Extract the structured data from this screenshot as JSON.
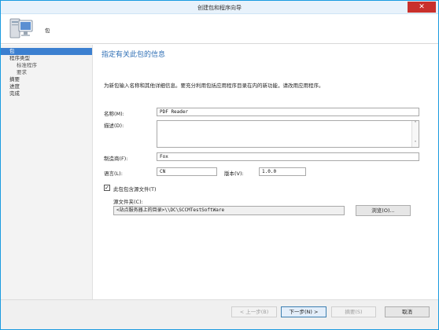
{
  "window": {
    "title": "创建包和程序向导",
    "close_glyph": "✕"
  },
  "header": {
    "title": "包",
    "icon": "computer-icon"
  },
  "sidebar": {
    "items": [
      {
        "label": "包",
        "active": true
      },
      {
        "label": "程序类型",
        "active": false
      },
      {
        "label": "标准程序",
        "active": false
      },
      {
        "label": "要求",
        "active": false
      },
      {
        "label": "摘要",
        "active": false
      },
      {
        "label": "进度",
        "active": false
      },
      {
        "label": "完成",
        "active": false
      }
    ]
  },
  "main": {
    "section_title": "指定有关此包的信息",
    "instruction": "为新包输入名称和其他详细信息。要充分利用包括应用程序目录在内的新功能，请改用应用程序。",
    "fields": {
      "name_label": "名称(M):",
      "name_value": "PDF Reader",
      "description_label": "描述(D):",
      "description_value": "",
      "manufacturer_label": "制造商(F):",
      "manufacturer_value": "Fox",
      "language_label": "语言(L):",
      "language_value": "CN",
      "version_label": "版本(V):",
      "version_value": "1.0.0"
    },
    "source": {
      "checkbox_label": "此包包含源文件(T)",
      "checked": true,
      "check_glyph": "✓",
      "folder_label": "源文件夹(C):",
      "folder_value": "<站点服务器上的目录>\\\\DC\\SCCMTestSoftWare",
      "browse_label": "浏览(O)..."
    }
  },
  "footer": {
    "back_label": "< 上一步(B)",
    "next_label": "下一步(N) >",
    "summary_label": "摘要(S)",
    "cancel_label": "取消"
  }
}
